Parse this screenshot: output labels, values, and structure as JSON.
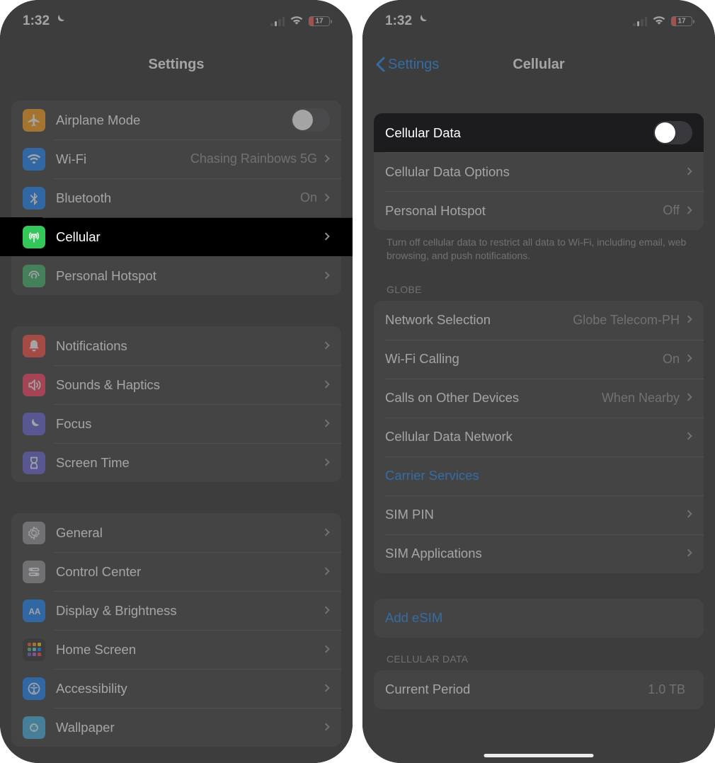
{
  "status": {
    "time": "1:32",
    "battery_pct": "17"
  },
  "left": {
    "title": "Settings",
    "groups": [
      {
        "rows": [
          {
            "icon": "airplane-icon",
            "label": "Airplane Mode",
            "toggle": false
          },
          {
            "icon": "wifi-icon",
            "label": "Wi-Fi",
            "detail": "Chasing Rainbows 5G",
            "chev": true
          },
          {
            "icon": "bluetooth-icon",
            "label": "Bluetooth",
            "detail": "On",
            "chev": true
          },
          {
            "icon": "cellular-icon",
            "label": "Cellular",
            "chev": true,
            "highlight": true
          },
          {
            "icon": "hotspot-icon",
            "label": "Personal Hotspot",
            "chev": true
          }
        ]
      },
      {
        "rows": [
          {
            "icon": "notifications-icon",
            "label": "Notifications",
            "chev": true
          },
          {
            "icon": "sounds-icon",
            "label": "Sounds & Haptics",
            "chev": true
          },
          {
            "icon": "focus-icon",
            "label": "Focus",
            "chev": true
          },
          {
            "icon": "screen-time-icon",
            "label": "Screen Time",
            "chev": true
          }
        ]
      },
      {
        "rows": [
          {
            "icon": "general-icon",
            "label": "General",
            "chev": true
          },
          {
            "icon": "control-center-icon",
            "label": "Control Center",
            "chev": true
          },
          {
            "icon": "display-icon",
            "label": "Display & Brightness",
            "chev": true
          },
          {
            "icon": "home-screen-icon",
            "label": "Home Screen",
            "chev": true
          },
          {
            "icon": "accessibility-icon",
            "label": "Accessibility",
            "chev": true
          },
          {
            "icon": "wallpaper-icon",
            "label": "Wallpaper",
            "chev": true
          }
        ]
      }
    ]
  },
  "right": {
    "back": "Settings",
    "title": "Cellular",
    "section1": {
      "cellular_data_label": "Cellular Data",
      "options_label": "Cellular Data Options",
      "hotspot_label": "Personal Hotspot",
      "hotspot_value": "Off"
    },
    "footnote": "Turn off cellular data to restrict all data to Wi-Fi, including email, web browsing, and push notifications.",
    "carrier_header": "GLOBE",
    "carrier_rows": {
      "network_selection": "Network Selection",
      "network_selection_value": "Globe Telecom-PH",
      "wifi_calling": "Wi-Fi Calling",
      "wifi_calling_value": "On",
      "calls_other": "Calls on Other Devices",
      "calls_other_value": "When Nearby",
      "data_network": "Cellular Data Network",
      "carrier_services": "Carrier Services",
      "sim_pin": "SIM PIN",
      "sim_apps": "SIM Applications"
    },
    "add_esim": "Add eSIM",
    "usage_header": "CELLULAR DATA",
    "current_period": "Current Period",
    "current_period_value": "1.0 TB"
  }
}
